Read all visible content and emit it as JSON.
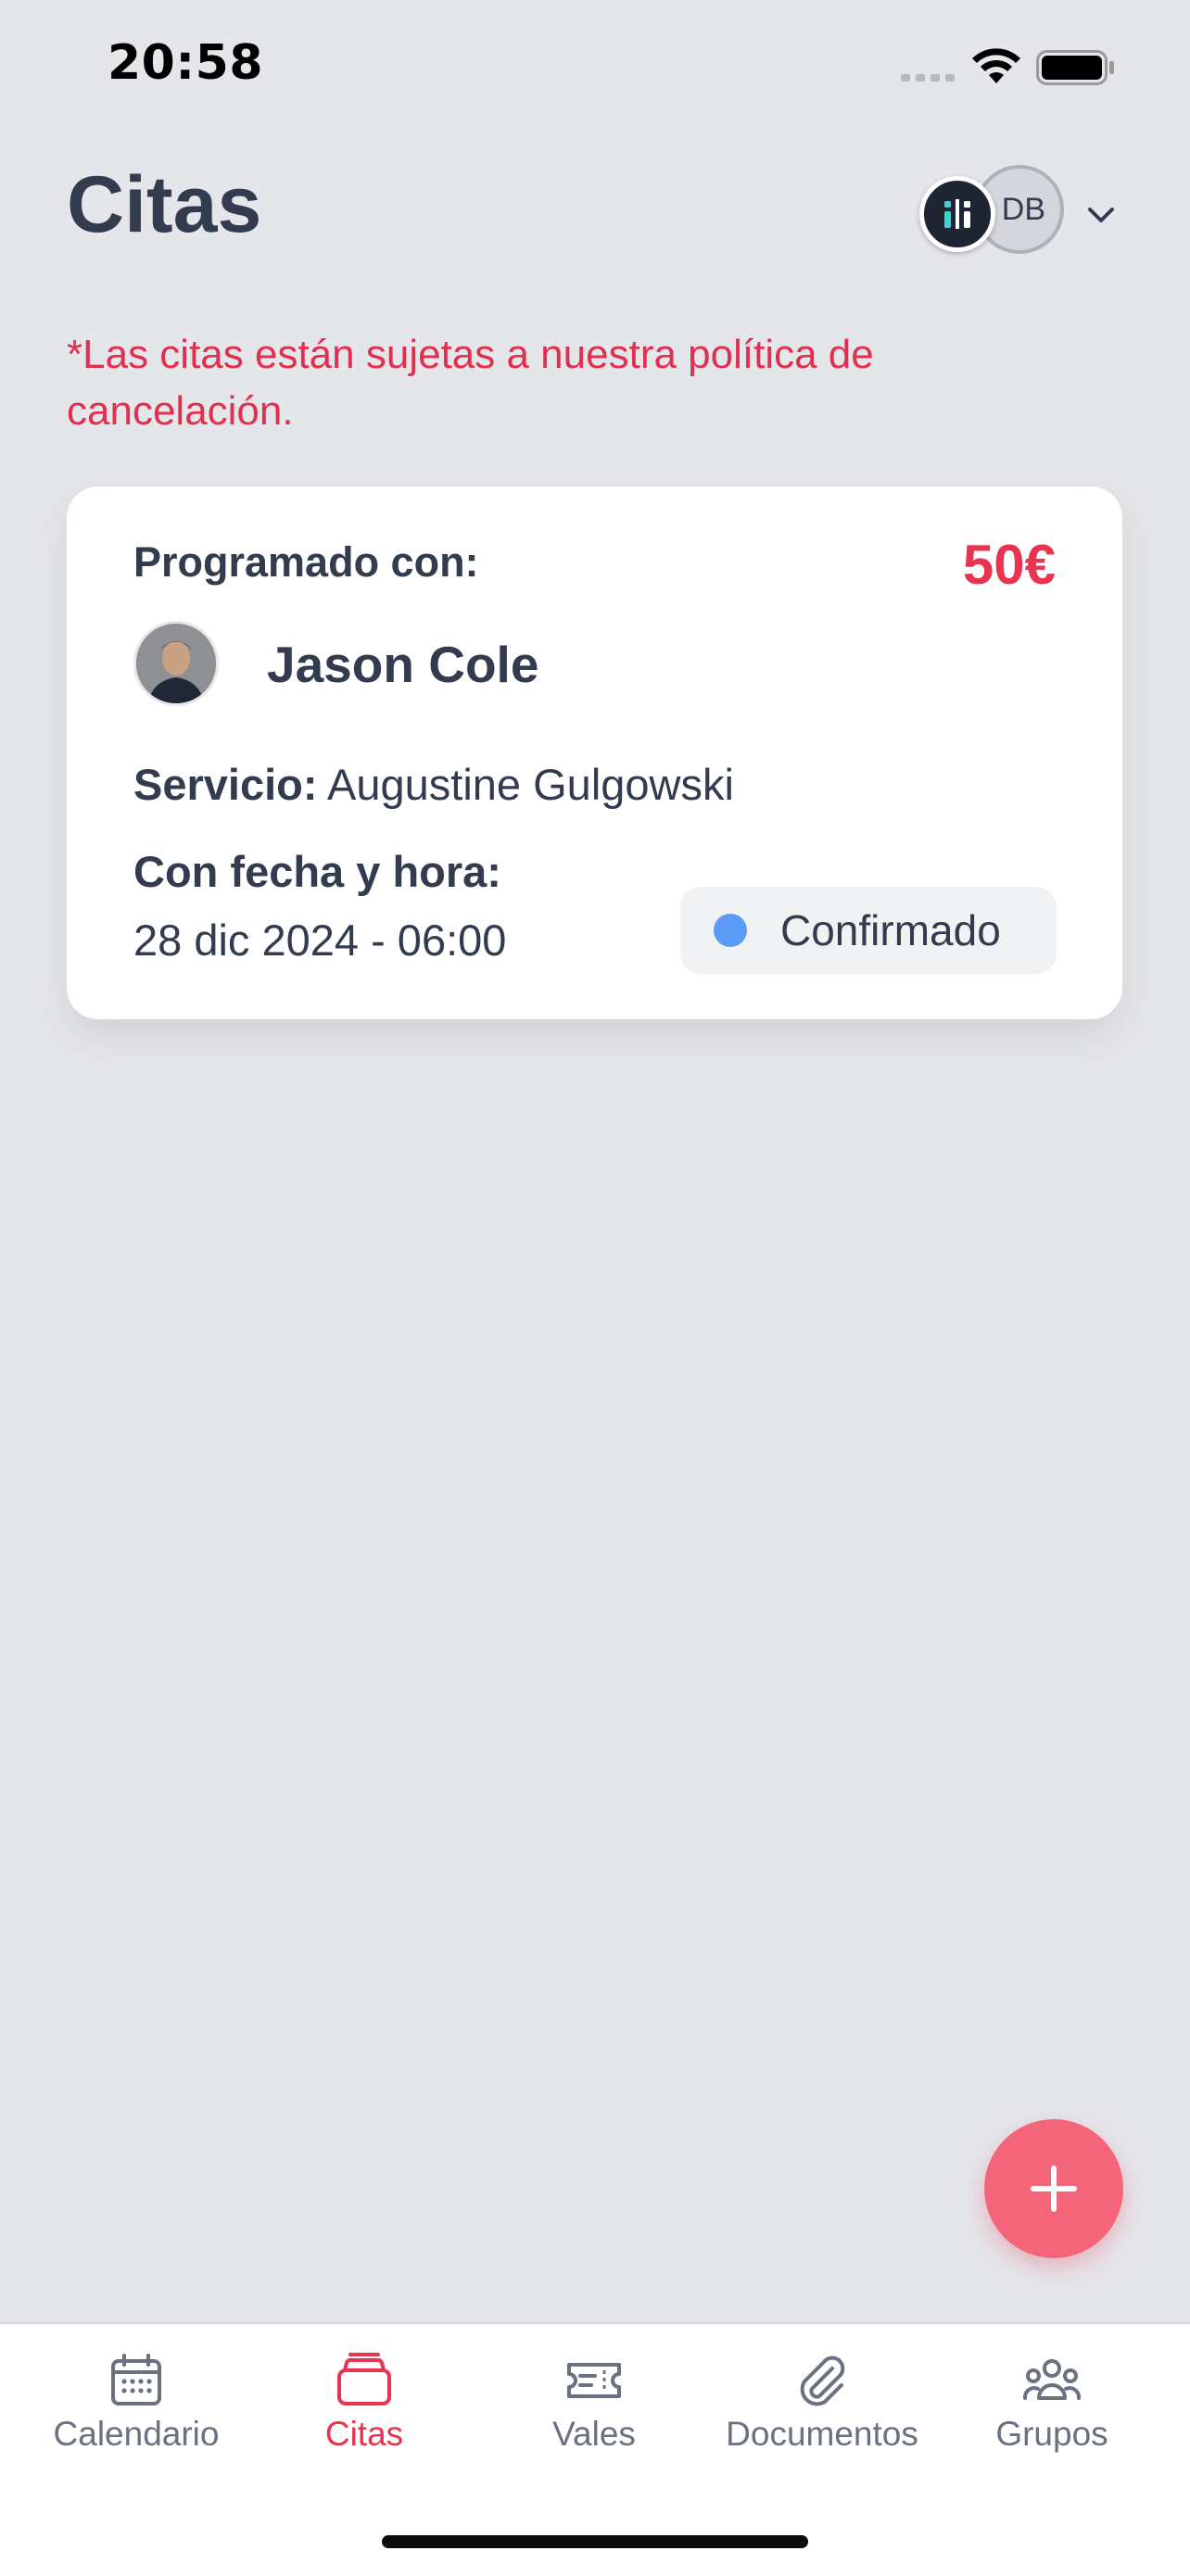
{
  "status_bar": {
    "time": "20:58"
  },
  "header": {
    "title": "Citas",
    "avatar_initials": "DB"
  },
  "notice": {
    "text": "*Las citas están sujetas a nuestra política de cancelación."
  },
  "appointment": {
    "scheduled_label": "Programado con:",
    "price": "50€",
    "provider_name": "Jason Cole",
    "service_label": "Servicio:",
    "service_value": "Augustine Gulgowski",
    "date_label": "Con fecha y hora:",
    "date_value": "28 dic 2024 - 06:00",
    "status": "Confirmado",
    "status_color": "#5b9cf6"
  },
  "colors": {
    "accent": "#e8344f",
    "fab": "#f5657a",
    "background": "#e5e6ea",
    "text_primary": "#333b4e"
  },
  "tab_bar": {
    "tabs": [
      {
        "label": "Calendario",
        "icon": "calendar-icon",
        "active": false
      },
      {
        "label": "Citas",
        "icon": "appointments-icon",
        "active": true
      },
      {
        "label": "Vales",
        "icon": "voucher-icon",
        "active": false
      },
      {
        "label": "Documentos",
        "icon": "paperclip-icon",
        "active": false
      },
      {
        "label": "Grupos",
        "icon": "group-icon",
        "active": false
      }
    ]
  }
}
